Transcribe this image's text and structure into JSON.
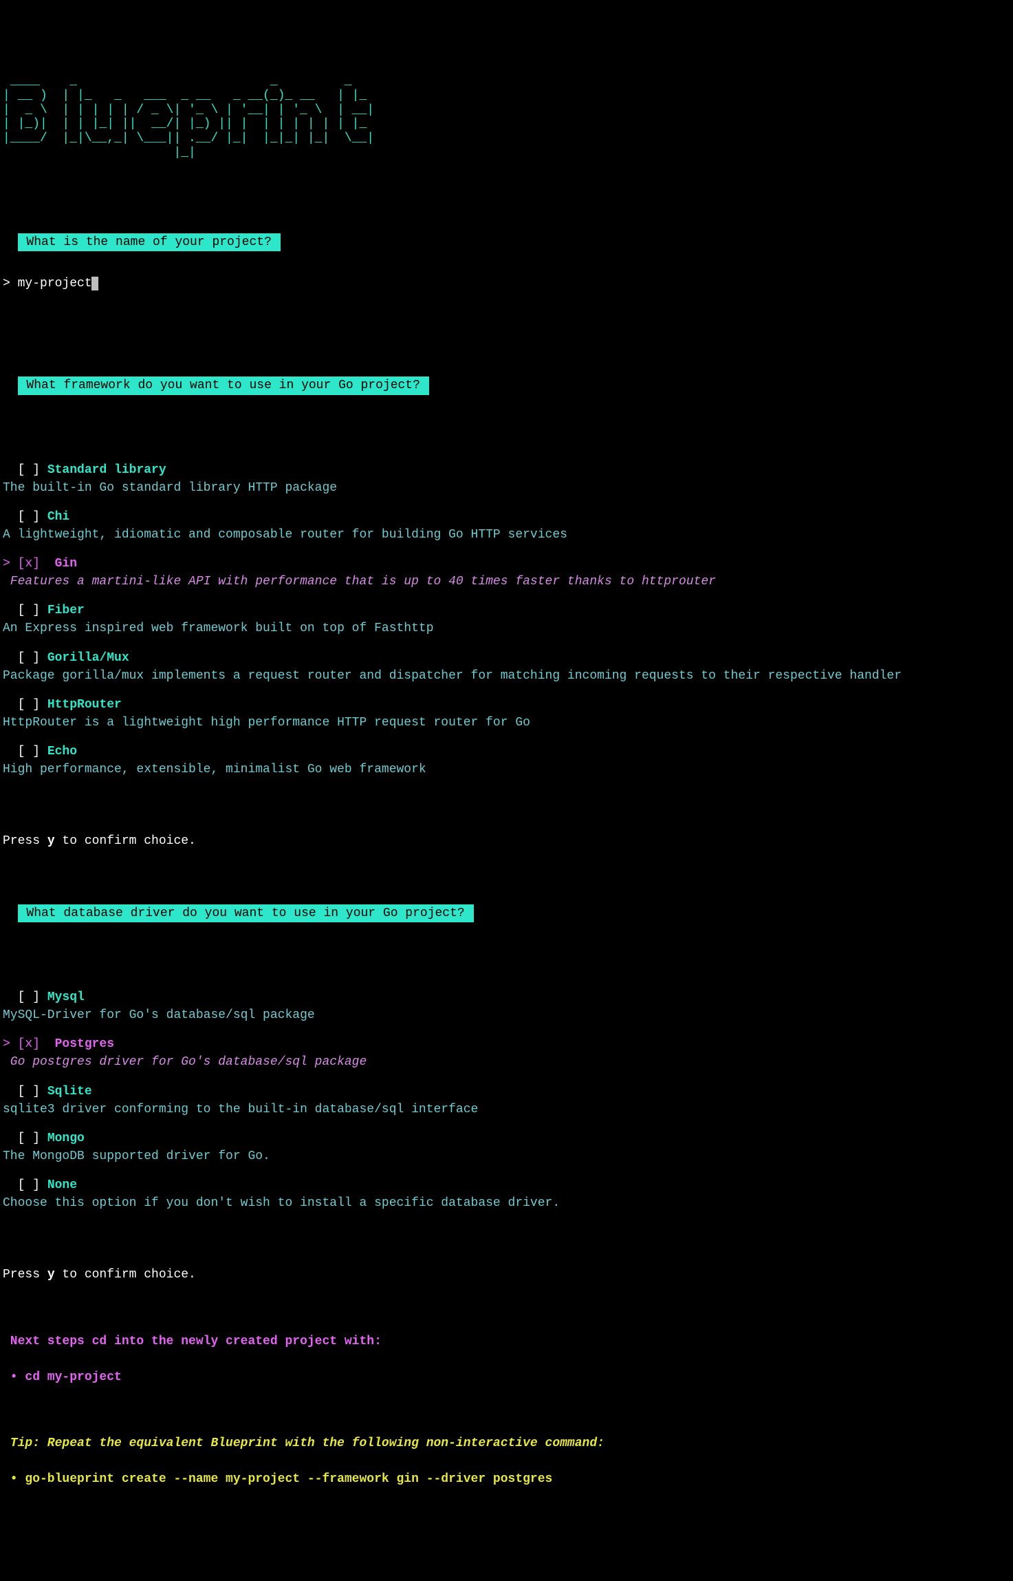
{
  "ascii_logo": " ____    _                          _         _   \n| __ )  | |_   _   ___  _ __   _ __(_)_ __   | |_ \n|  _ \\  | | | | | / _ \\| '_ \\ | '__| | '_ \\  | __|\n| |_)|  | | |_| ||  __/| |_) || |  | | | | | | |_ \n|____/  |_|\\__,_| \\___|| .__/ |_|  |_|_| |_|  \\__|\n                       |_|                        ",
  "q1": {
    "header": " What is the name of your project? ",
    "caret": "> ",
    "value": "my-project"
  },
  "q2": {
    "header": " What framework do you want to use in your Go project? ",
    "options": [
      {
        "name": "Standard library",
        "desc": "The built-in Go standard library HTTP package",
        "selected": false
      },
      {
        "name": "Chi",
        "desc": "A lightweight, idiomatic and composable router for building Go HTTP services",
        "selected": false
      },
      {
        "name": "Gin",
        "desc": "Features a martini-like API with performance that is up to 40 times faster thanks to httprouter",
        "selected": true
      },
      {
        "name": "Fiber",
        "desc": "An Express inspired web framework built on top of Fasthttp",
        "selected": false
      },
      {
        "name": "Gorilla/Mux",
        "desc": "Package gorilla/mux implements a request router and dispatcher for matching incoming requests to their respective handler",
        "selected": false
      },
      {
        "name": "HttpRouter",
        "desc": "HttpRouter is a lightweight high performance HTTP request router for Go",
        "selected": false
      },
      {
        "name": "Echo",
        "desc": "High performance, extensible, minimalist Go web framework",
        "selected": false
      }
    ]
  },
  "confirm": {
    "prefix": "Press ",
    "key": "y",
    "suffix": " to confirm choice."
  },
  "q3": {
    "header": " What database driver do you want to use in your Go project? ",
    "options": [
      {
        "name": "Mysql",
        "desc": "MySQL-Driver for Go's database/sql package",
        "selected": false
      },
      {
        "name": "Postgres",
        "desc": "Go postgres driver for Go's database/sql package",
        "selected": true
      },
      {
        "name": "Sqlite",
        "desc": "sqlite3 driver conforming to the built-in database/sql interface",
        "selected": false
      },
      {
        "name": "Mongo",
        "desc": "The MongoDB supported driver for Go.",
        "selected": false
      },
      {
        "name": "None",
        "desc": "Choose this option if you don't wish to install a specific database driver.",
        "selected": false
      }
    ]
  },
  "next_steps": {
    "title": " Next steps cd into the newly created project with:",
    "bullet": " • cd my-project"
  },
  "tip": {
    "title": " Tip: Repeat the equivalent Blueprint with the following non-interactive command:",
    "cmd": " • go-blueprint create --name my-project --framework gin --driver postgres"
  }
}
